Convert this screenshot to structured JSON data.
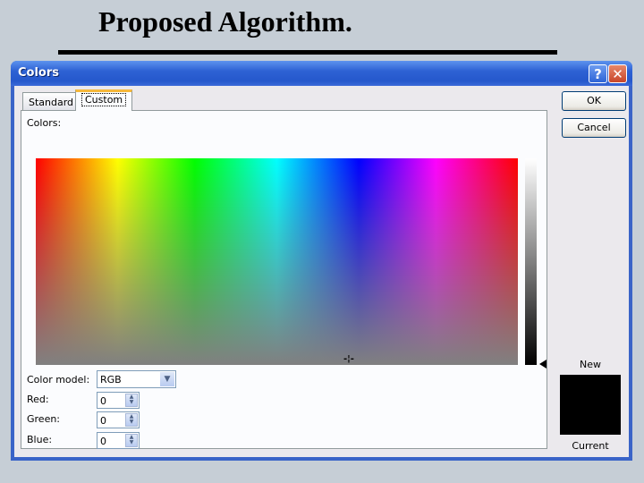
{
  "slide": {
    "title": "Proposed Algorithm."
  },
  "dialog": {
    "title": "Colors",
    "help_label": "?",
    "close_label": "✕",
    "tabs": [
      {
        "label": "Standard"
      },
      {
        "label": "Custom"
      }
    ],
    "active_tab": "Custom",
    "colors_label": "Colors:",
    "buttons": {
      "ok": "OK",
      "cancel": "Cancel"
    },
    "color_model": {
      "label": "Color model:",
      "value": "RGB"
    },
    "red": {
      "label": "Red:",
      "value": "0"
    },
    "green": {
      "label": "Green:",
      "value": "0"
    },
    "blue": {
      "label": "Blue:",
      "value": "0"
    },
    "new_label": "New",
    "current_label": "Current",
    "new_color": "#000000",
    "current_color": "#000000"
  }
}
